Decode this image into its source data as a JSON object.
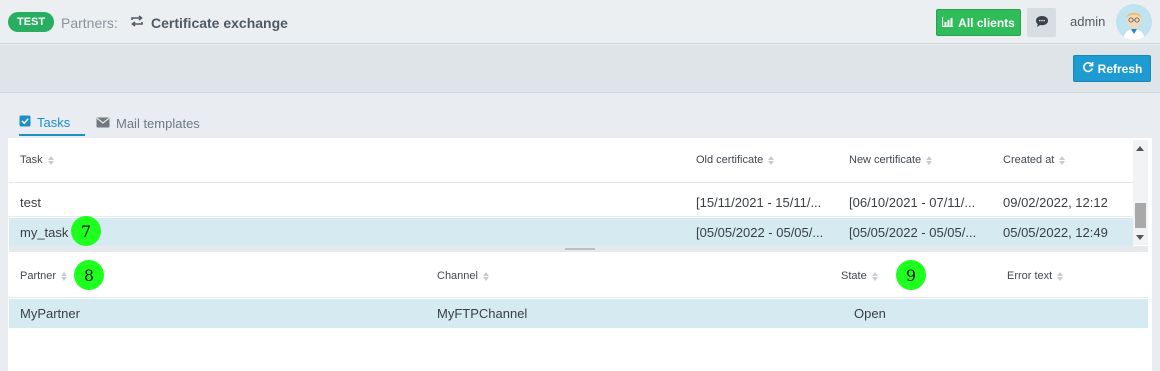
{
  "header": {
    "env_badge": "TEST",
    "breadcrumb_prefix": "Partners:",
    "breadcrumb_title": "Certificate exchange",
    "all_clients_label": "All clients",
    "username": "admin"
  },
  "toolbar": {
    "refresh_label": "Refresh"
  },
  "tabs": [
    {
      "label": "Tasks",
      "active": true
    },
    {
      "label": "Mail templates",
      "active": false
    }
  ],
  "tasks_table": {
    "columns": [
      "Task",
      "Old certificate",
      "New certificate",
      "Created at"
    ],
    "rows": [
      {
        "task": "test",
        "old_cert": "[15/11/2021 - 15/11/...",
        "new_cert": "[06/10/2021 - 07/11/...",
        "created_at": "09/02/2022, 12:12",
        "selected": false
      },
      {
        "task": "my_task",
        "old_cert": "[05/05/2022 - 05/05/...",
        "new_cert": "[05/05/2022 - 05/05/...",
        "created_at": "05/05/2022, 12:49",
        "selected": true
      }
    ]
  },
  "partners_table": {
    "columns": [
      "Partner",
      "Channel",
      "State",
      "Error text"
    ],
    "rows": [
      {
        "partner": "MyPartner",
        "channel": "MyFTPChannel",
        "state": "Open",
        "error_text": ""
      }
    ]
  },
  "markers": [
    "7",
    "8",
    "9"
  ],
  "colors": {
    "badge_green": "#27ae60",
    "all_clients_green": "#2ebd59",
    "refresh_blue": "#1e9bd0",
    "active_tab_blue": "#1e8fc3",
    "selected_row": "#d5ebf1",
    "marker_green": "#1dff1d"
  },
  "icons": {
    "breadcrumb": "repeat-icon",
    "all_clients": "chart-icon",
    "chat": "chat-bubble-icon",
    "refresh": "refresh-icon",
    "tasks_tab": "checkbox-icon",
    "mail_tab": "envelope-icon"
  }
}
